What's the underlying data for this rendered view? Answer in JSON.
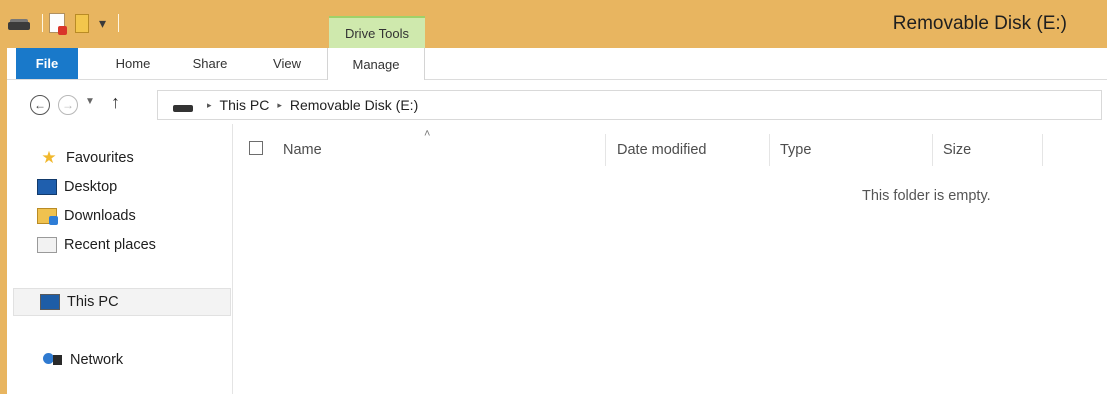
{
  "window": {
    "title": "Removable Disk (E:)",
    "accent_color": "#e8b560"
  },
  "quick_access_toolbar": {
    "icons": [
      "drive-icon",
      "properties-icon",
      "new-folder-icon",
      "customize-dropdown-icon"
    ],
    "dropdown_glyph": "▾"
  },
  "ribbon": {
    "contextual_group": "Drive Tools",
    "contextual_color": "#cfe9ad",
    "tabs": [
      "File",
      "Home",
      "Share",
      "View",
      "Manage"
    ],
    "file_tab_color": "#1979ca"
  },
  "address_bar": {
    "back_glyph": "←",
    "forward_glyph": "→",
    "recent_glyph": "▼",
    "up_glyph": "↑",
    "separator": "▸",
    "breadcrumbs": [
      "This PC",
      "Removable Disk (E:)"
    ]
  },
  "nav_pane": {
    "favourites": {
      "label": "Favourites",
      "icon": "star-icon",
      "items": [
        {
          "label": "Desktop",
          "icon": "desktop-icon"
        },
        {
          "label": "Downloads",
          "icon": "downloads-icon"
        },
        {
          "label": "Recent places",
          "icon": "recent-places-icon"
        }
      ]
    },
    "this_pc": {
      "label": "This PC",
      "icon": "computer-icon",
      "selected": true
    },
    "network": {
      "label": "Network",
      "icon": "network-icon"
    }
  },
  "content": {
    "columns": [
      "Name",
      "Date modified",
      "Type",
      "Size"
    ],
    "sorted_by": "Name",
    "sort_glyph": "˄",
    "empty_message": "This folder is empty."
  }
}
